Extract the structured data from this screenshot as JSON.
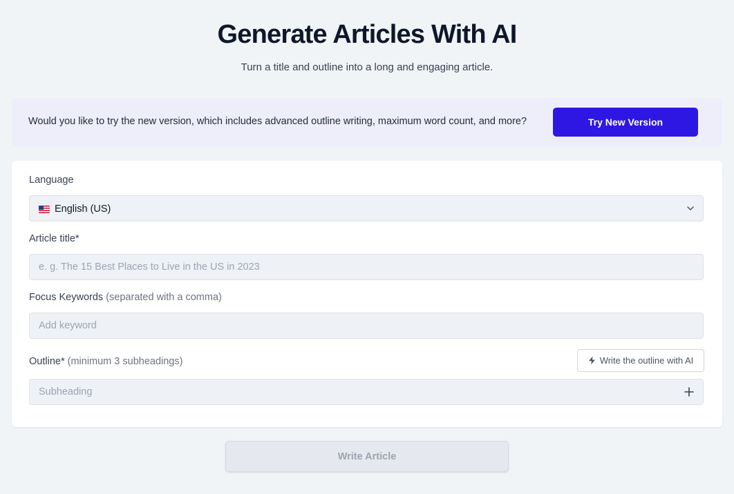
{
  "header": {
    "title": "Generate Articles With AI",
    "subtitle": "Turn a title and outline into a long and engaging article."
  },
  "banner": {
    "text": "Would you like to try the new version, which includes advanced outline writing, maximum word count, and more?",
    "button_label": "Try New Version"
  },
  "form": {
    "language": {
      "label": "Language",
      "selected": "English (US)",
      "flag_icon": "us-flag-icon"
    },
    "article_title": {
      "label": "Article title*",
      "placeholder": "e. g. The 15 Best Places to Live in the US in 2023"
    },
    "keywords": {
      "label": "Focus Keywords",
      "hint": "(separated with a comma)",
      "placeholder": "Add keyword"
    },
    "outline": {
      "label": "Outline*",
      "hint": "(minimum 3 subheadings)",
      "ai_button_label": "Write the outline with AI",
      "placeholder": "Subheading"
    },
    "submit_label": "Write Article"
  },
  "colors": {
    "background": "#f1f4f7",
    "banner_background": "#eeeefa",
    "primary": "#2f17e3",
    "field_background": "#eef1f5",
    "disabled_button": "#e5e9ef"
  }
}
